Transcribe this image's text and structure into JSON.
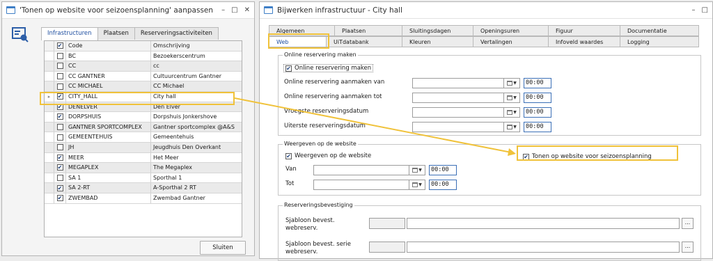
{
  "left_window": {
    "title": "'Tonen op website voor seizoensplanning' aanpassen",
    "controls": [
      "–",
      "□",
      "✕"
    ],
    "tabs": [
      "Infrastructuren",
      "Plaatsen",
      "Reserveringsactiviteiten"
    ],
    "grid": {
      "headers": {
        "code": "Code",
        "description": "Omschrijving"
      },
      "rows": [
        {
          "code": "BC",
          "description": "Bezoekerscentrum",
          "checked": "",
          "mark": ""
        },
        {
          "code": "CC",
          "description": "cc",
          "checked": "",
          "mark": ""
        },
        {
          "code": "CC GANTNER",
          "description": "Cultuurcentrum Gantner",
          "checked": "",
          "mark": ""
        },
        {
          "code": "CC MICHAEL",
          "description": "CC Michael",
          "checked": "",
          "mark": ""
        },
        {
          "code": "CITY_HALL",
          "description": "City hall",
          "checked": "✔",
          "mark": "▸"
        },
        {
          "code": "DENELVER",
          "description": "Den Elver",
          "checked": "✔",
          "mark": ""
        },
        {
          "code": "DORPSHUIS",
          "description": "Dorpshuis Jonkershove",
          "checked": "✔",
          "mark": ""
        },
        {
          "code": "GANTNER SPORTCOMPLEX",
          "description": "Gantner sportcomplex @A&S",
          "checked": "",
          "mark": ""
        },
        {
          "code": "GEMEENTEHUIS",
          "description": "Gemeentehuis",
          "checked": "",
          "mark": ""
        },
        {
          "code": "JH",
          "description": "Jeugdhuis Den Overkant",
          "checked": "",
          "mark": ""
        },
        {
          "code": "MEER",
          "description": "Het Meer",
          "checked": "✔",
          "mark": ""
        },
        {
          "code": "MEGAPLEX",
          "description": "The Megaplex",
          "checked": "✔",
          "mark": ""
        },
        {
          "code": "SA 1",
          "description": "Sporthal 1",
          "checked": "",
          "mark": ""
        },
        {
          "code": "SA 2-RT",
          "description": "A-Sporthal 2 RT",
          "checked": "✔",
          "mark": ""
        },
        {
          "code": "ZWEMBAD",
          "description": "Zwembad Gantner",
          "checked": "✔",
          "mark": ""
        }
      ]
    },
    "close_button": "Sluiten"
  },
  "right_window": {
    "title": "Bijwerken infrastructuur - City hall",
    "controls": [
      "–",
      "□"
    ],
    "tabs_row1": [
      "Algemeen",
      "Plaatsen",
      "Sluitingsdagen",
      "Openingsuren",
      "Figuur",
      "Documentatie"
    ],
    "tabs_row2": [
      "Web",
      "UiTdatabank",
      "Kleuren",
      "Vertalingen",
      "Infoveld waardes",
      "Logging"
    ],
    "online_group": {
      "title": "Online reservering maken",
      "checkbox": "Online reservering maken",
      "fields": [
        {
          "label": "Online reservering aanmaken van",
          "time": "00:00"
        },
        {
          "label": "Online reservering aanmaken tot",
          "time": "00:00"
        },
        {
          "label": "Vroegste reserveringsdatum",
          "time": "00:00"
        },
        {
          "label": "Uiterste reserveringsdatum",
          "time": "00:00"
        }
      ]
    },
    "web_group": {
      "title": "Weergeven op de website",
      "checkbox": "Weergeven op de website",
      "seizoen_checkbox": "Tonen op website voor seizoensplanning",
      "fields": [
        {
          "label": "Van",
          "time": "00:00"
        },
        {
          "label": "Tot",
          "time": "00:00"
        }
      ]
    },
    "confirm_group": {
      "title": "Reserveringsbevestiging",
      "fields": [
        {
          "label": "Sjabloon bevest. webreserv.",
          "button": "..."
        },
        {
          "label": "Sjabloon bevest. serie webreserv.",
          "button": "..."
        }
      ]
    }
  },
  "check_mark": "✔",
  "colors": {
    "highlight": "#f0c23a",
    "accent": "#3f7fc6"
  }
}
